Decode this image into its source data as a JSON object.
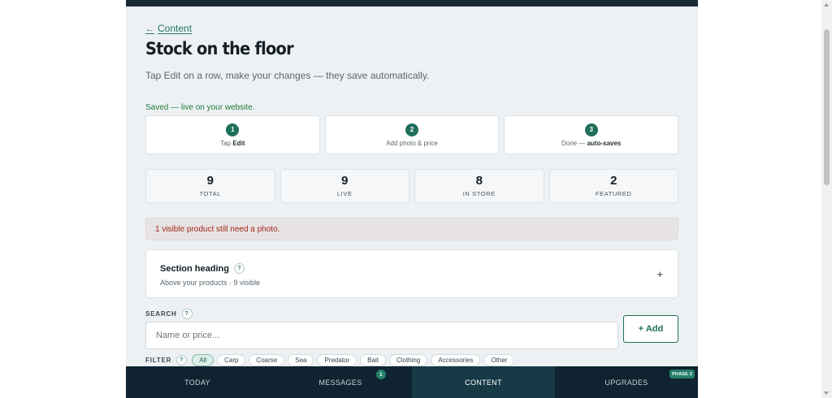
{
  "breadcrumb": {
    "arrow": "←",
    "label": "Content"
  },
  "page": {
    "title": "Stock on the floor",
    "subtitle": "Tap Edit on a row, make your changes — they save automatically.",
    "saved_status": "Saved — live on your website."
  },
  "steps": [
    {
      "number": "1",
      "text_prefix": "Tap ",
      "text_strong": "Edit"
    },
    {
      "number": "2",
      "text_prefix": "Add photo & price",
      "text_strong": ""
    },
    {
      "number": "3",
      "text_prefix": "Done — ",
      "text_strong": "auto-saves"
    }
  ],
  "stats": [
    {
      "value": "9",
      "label": "TOTAL"
    },
    {
      "value": "9",
      "label": "LIVE"
    },
    {
      "value": "8",
      "label": "IN STORE"
    },
    {
      "value": "2",
      "label": "FEATURED"
    }
  ],
  "alert": {
    "text": "1 visible product still need a photo."
  },
  "section": {
    "title": "Section heading",
    "help": "?",
    "subtitle": "Above your products · 9 visible",
    "expand": "+"
  },
  "search": {
    "label": "SEARCH",
    "help": "?",
    "placeholder": "Name or price...",
    "value": ""
  },
  "add_button": "+ Add",
  "filter": {
    "label": "FILTER",
    "help": "?",
    "chips": [
      "All",
      "Carp",
      "Coarse",
      "Sea",
      "Predator",
      "Bait",
      "Clothing",
      "Accessories",
      "Other"
    ],
    "selected": "All"
  },
  "nav": {
    "tabs": [
      {
        "label": "TODAY"
      },
      {
        "label": "MESSAGES",
        "badge": "1"
      },
      {
        "label": "CONTENT",
        "active": true
      },
      {
        "label": "UPGRADES",
        "badge": "PHASE 2"
      }
    ]
  },
  "icons": {
    "back": "left-arrow-icon",
    "help": "question-circle-icon",
    "expand": "plus-icon"
  },
  "colors": {
    "accent": "#1e6f5c",
    "nav_background": "#0f2430",
    "nav_active": "#163a46",
    "alert_text": "#a2261c",
    "saved_text": "#1f7a3a",
    "page_background": "#edf1f4"
  }
}
